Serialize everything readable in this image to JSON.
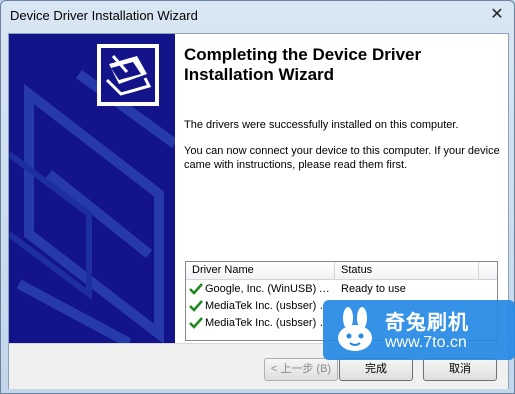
{
  "window": {
    "title": "Device Driver Installation Wizard",
    "close_glyph": "✕"
  },
  "wizard": {
    "heading": "Completing the Device Driver Installation Wizard",
    "para1": "The drivers were successfully installed on this computer.",
    "para2": "You can now connect your device to this computer. If your device came with instructions, please read them first."
  },
  "driver_list": {
    "columns": [
      "Driver Name",
      "Status"
    ],
    "rows": [
      {
        "name": "Google, Inc. (WinUSB) A...",
        "status": "Ready to use"
      },
      {
        "name": "MediaTek Inc. (usbser) P...",
        "status": ""
      },
      {
        "name": "MediaTek Inc. (usbser) P...",
        "status": ""
      }
    ]
  },
  "buttons": {
    "back": "< 上一步 (B)",
    "finish": "完成",
    "cancel": "取消"
  },
  "watermark": {
    "title": "奇兔刷机",
    "url": "www.7to.cn"
  },
  "colors": {
    "left_panel": "#14148a",
    "check": "#1e8a1e",
    "watermark": "#268ae4"
  },
  "icons": {
    "wizard": "device-box-icon",
    "check": "check-icon",
    "close": "close-icon",
    "logo": "rabbit-logo-icon"
  }
}
